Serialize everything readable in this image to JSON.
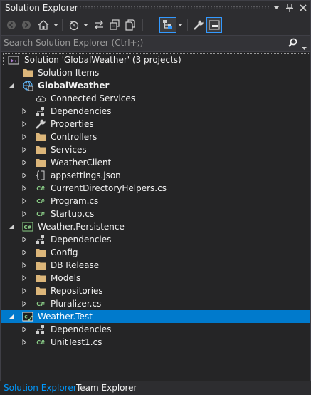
{
  "window": {
    "title": "Solution Explorer"
  },
  "search": {
    "placeholder": "Search Solution Explorer (Ctrl+;)"
  },
  "tree": {
    "solution": "Solution 'GlobalWeather' (3 projects)",
    "solution_items": "Solution Items",
    "global_weather": {
      "name": "GlobalWeather",
      "connected_services": "Connected Services",
      "dependencies": "Dependencies",
      "properties": "Properties",
      "controllers": "Controllers",
      "services": "Services",
      "weather_client": "WeatherClient",
      "appsettings": "appsettings.json",
      "current_directory_helpers": "CurrentDirectoryHelpers.cs",
      "program": "Program.cs",
      "startup": "Startup.cs"
    },
    "weather_persistence": {
      "name": "Weather.Persistence",
      "dependencies": "Dependencies",
      "config": "Config",
      "db_release": "DB Release",
      "models": "Models",
      "repositories": "Repositories",
      "pluralizer": "Pluralizer.cs"
    },
    "weather_test": {
      "name": "Weather.Test",
      "dependencies": "Dependencies",
      "unit_test": "UnitTest1.cs"
    }
  },
  "tabs": {
    "solution_explorer": "Solution Explorer",
    "team_explorer": "Team Explorer"
  },
  "colors": {
    "background": "#252526",
    "selection": "#007acc",
    "accent_text": "#0097fb",
    "folder": "#dcb67a",
    "csharp": "#8dd28a"
  },
  "icons": {
    "toolbar": [
      "back-icon",
      "forward-icon",
      "home-icon",
      "dropdown-icon",
      "pending-changes-icon",
      "sync-icon",
      "collapse-all-icon",
      "show-all-files-icon",
      "sync-active-document-icon",
      "properties-wrench-icon",
      "preview-selected-items-icon"
    ]
  }
}
